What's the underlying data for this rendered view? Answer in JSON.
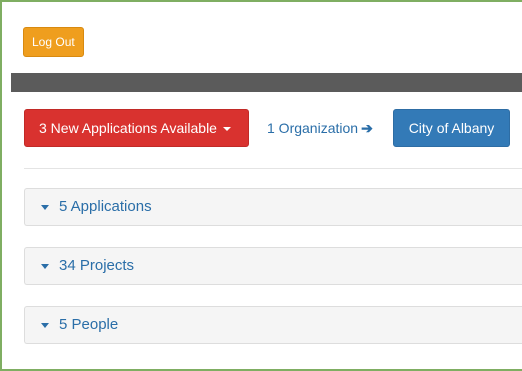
{
  "header": {
    "logout_label": "Log Out"
  },
  "toolbar": {
    "new_applications_label": "3 New Applications Available",
    "organization_link": "1 Organization",
    "organization_button": "City of Albany"
  },
  "panels": [
    {
      "label": "5 Applications"
    },
    {
      "label": "34 Projects"
    },
    {
      "label": "5 People"
    }
  ],
  "colors": {
    "logout": "#ef9e1e",
    "danger": "#d9322f",
    "primary": "#337ab7",
    "link": "#2a6ea8",
    "topbar": "#5b5b5b"
  }
}
